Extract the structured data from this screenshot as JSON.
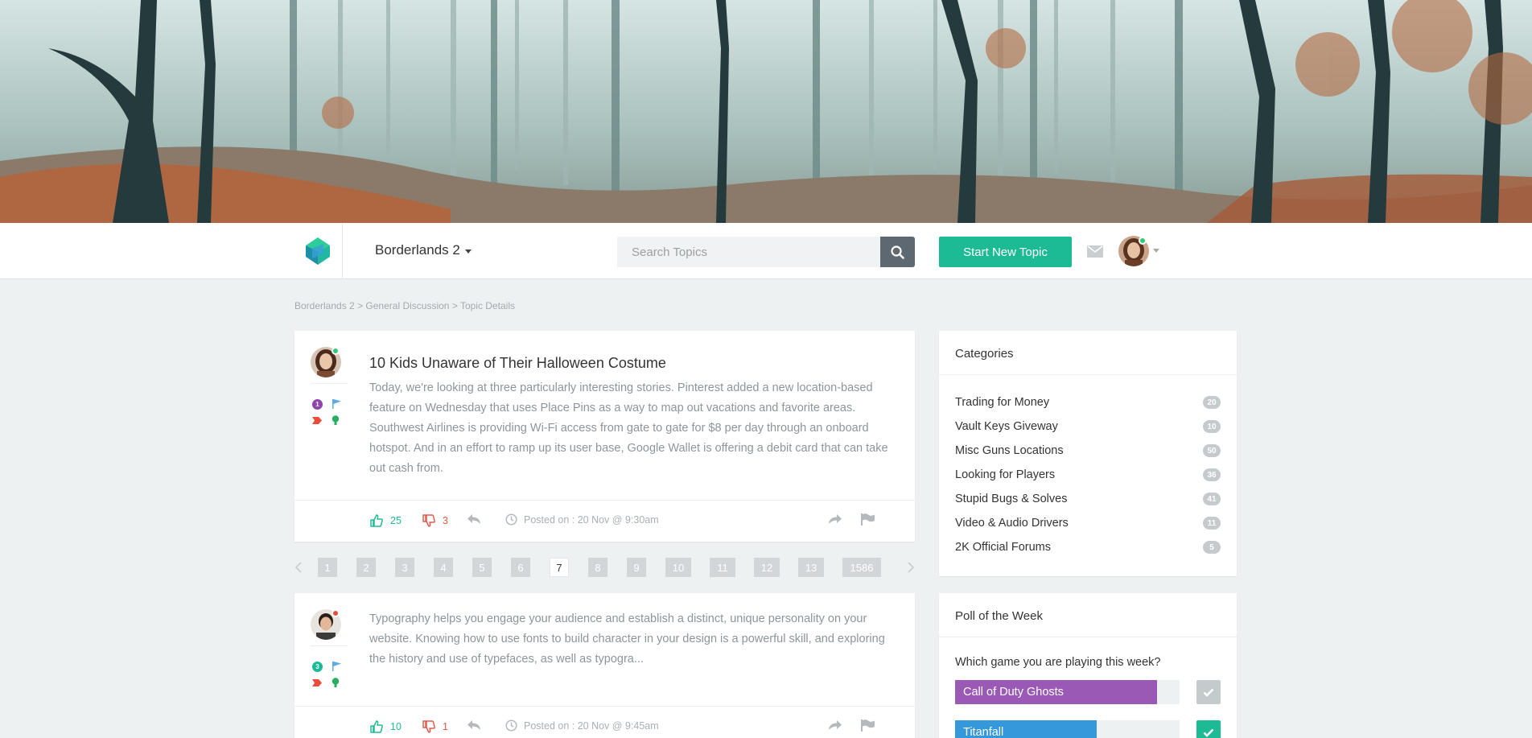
{
  "header": {
    "brand": "Borderlands 2",
    "search_placeholder": "Search Topics",
    "new_topic_label": "Start New Topic"
  },
  "breadcrumb": {
    "items": [
      "Borderlands 2",
      "General Discussion",
      "Topic Details"
    ],
    "separator": ">"
  },
  "posts": [
    {
      "title": "10 Kids Unaware of Their Halloween Costume",
      "text": "Today, we're looking at three particularly interesting stories. Pinterest added a new location-based feature on Wednesday that uses Place Pins as a way to map out vacations and favorite areas. Southwest Airlines is providing Wi-Fi access from gate to gate for $8 per day through an onboard hotspot. And in an effort to ramp up its user base, Google Wallet is offering a debit card that can take out cash from.",
      "badge_number": "1",
      "badge_color": "#8e44ad",
      "status_color": "#2ecc71",
      "likes": "25",
      "dislikes": "3",
      "posted": "Posted on : 20 Nov @ 9:30am"
    },
    {
      "title": "",
      "text": "Typography helps you engage your audience and establish a distinct, unique personality on your website. Knowing how to use fonts to build character in your design is a powerful skill, and exploring the history and use of typefaces, as well as typogra...",
      "badge_number": "3",
      "badge_color": "#1dba96",
      "status_color": "#e74c3c",
      "likes": "10",
      "dislikes": "1",
      "posted": "Posted on : 20 Nov @ 9:45am"
    }
  ],
  "pagination": {
    "pages": [
      "1",
      "2",
      "3",
      "4",
      "5",
      "6",
      "7",
      "8",
      "9",
      "10",
      "11",
      "12",
      "13",
      "1586"
    ],
    "active": "7"
  },
  "categories": {
    "title": "Categories",
    "items": [
      {
        "label": "Trading for Money",
        "count": "20"
      },
      {
        "label": "Vault Keys Giveway",
        "count": "10"
      },
      {
        "label": "Misc Guns Locations",
        "count": "50"
      },
      {
        "label": "Looking for Players",
        "count": "36"
      },
      {
        "label": "Stupid Bugs & Solves",
        "count": "41"
      },
      {
        "label": "Video & Audio Drivers",
        "count": "11"
      },
      {
        "label": "2K Official Forums",
        "count": "5"
      }
    ]
  },
  "poll": {
    "title": "Poll of the Week",
    "question": "Which game you are playing this week?",
    "options": [
      {
        "label": "Call of Duty Ghosts",
        "percent": 90,
        "color": "#9b59b6",
        "selected": false
      },
      {
        "label": "Titanfall",
        "percent": 63,
        "color": "#3498db",
        "selected": true
      }
    ]
  },
  "colors": {
    "accent": "#1dba96",
    "like": "#1dba96",
    "dislike": "#e05b4b"
  }
}
